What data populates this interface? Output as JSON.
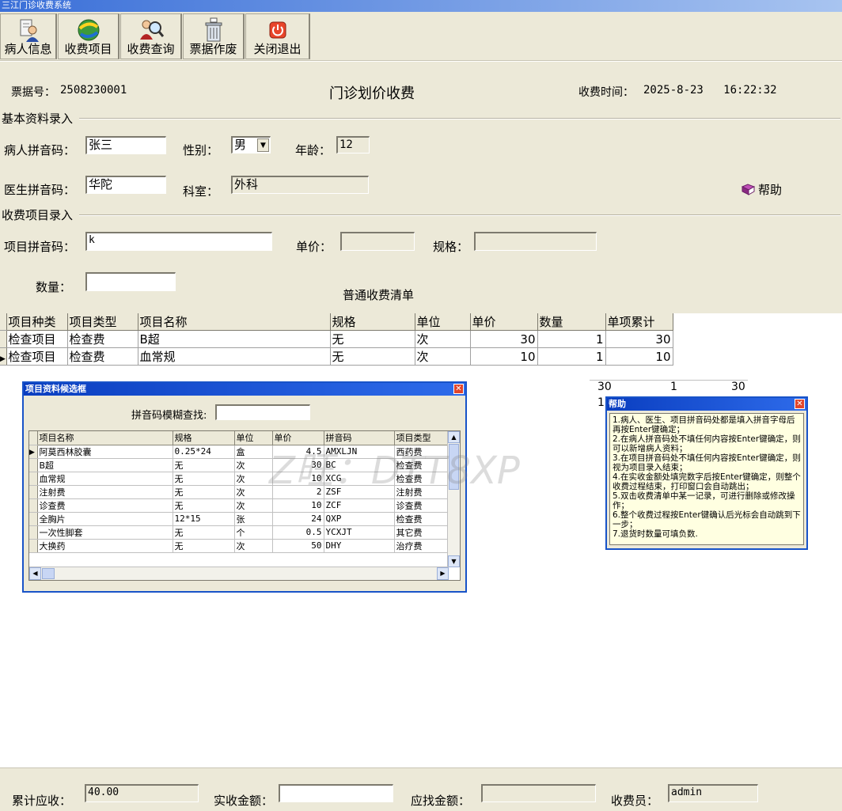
{
  "window": {
    "title": "三江门诊收费系统"
  },
  "toolbar": [
    {
      "label": "病人信息",
      "icon": "patient-icon"
    },
    {
      "label": "收费项目",
      "icon": "charge-items-icon"
    },
    {
      "label": "收费查询",
      "icon": "search-icon"
    },
    {
      "label": "票据作废",
      "icon": "trash-icon"
    },
    {
      "label": "关闭退出",
      "icon": "power-icon"
    }
  ],
  "header": {
    "receipt_label": "票据号：",
    "receipt_no": "2508230001",
    "title": "门诊划价收费",
    "time_label": "收费时间：",
    "time_value": "2025-8-23   16:22:32"
  },
  "basic": {
    "section": "基本资料录入",
    "patient_label": "病人拼音码：",
    "patient_value": "张三",
    "gender_label": "性别：",
    "gender_value": "男",
    "age_label": "年龄：",
    "age_value": "12",
    "doctor_label": "医生拼音码：",
    "doctor_value": "华陀",
    "dept_label": "科室：",
    "dept_value": "外科",
    "help_label": "帮助"
  },
  "item": {
    "section": "收费项目录入",
    "code_label": "项目拼音码：",
    "code_value": "k",
    "price_label": "单价：",
    "price_value": "",
    "spec_label": "规格：",
    "spec_value": "",
    "qty_label": "数量：",
    "qty_value": "",
    "list_title": "普通收费清单"
  },
  "main_grid": {
    "headers": [
      "项目种类",
      "项目类型",
      "项目名称",
      "规格",
      "单位",
      "单价",
      "数量",
      "单项累计"
    ],
    "rows": [
      [
        "检查项目",
        "检查费",
        "B超",
        "无",
        "次",
        "30",
        "1",
        "30"
      ],
      [
        "检查项目",
        "检查费",
        "血常规",
        "无",
        "次",
        "10",
        "1",
        "10"
      ]
    ]
  },
  "behind_row": {
    "a": "30",
    "b": "1",
    "c": "30",
    "d": "1"
  },
  "candidate": {
    "title": "项目资料候选框",
    "search_label": "拼音码模糊查找:",
    "search_value": "",
    "headers": [
      "项目名称",
      "规格",
      "单位",
      "单价",
      "拼音码",
      "项目类型"
    ],
    "rows": [
      [
        "阿莫西林胶囊",
        "0.25*24",
        "盒",
        "4.5",
        "AMXLJN",
        "西药费"
      ],
      [
        "B超",
        "无",
        "次",
        "30",
        "BC",
        "检查费"
      ],
      [
        "血常规",
        "无",
        "次",
        "10",
        "XCG",
        "检查费"
      ],
      [
        "注射费",
        "无",
        "次",
        "2",
        "ZSF",
        "注射费"
      ],
      [
        "诊查费",
        "无",
        "次",
        "10",
        "ZCF",
        "诊查费"
      ],
      [
        "全胸片",
        "12*15",
        "张",
        "24",
        "QXP",
        "检查费"
      ],
      [
        "一次性脚套",
        "无",
        "个",
        "0.5",
        "YCXJT",
        "其它费"
      ],
      [
        "大换药",
        "无",
        "次",
        "50",
        "DHY",
        "治疗费"
      ]
    ]
  },
  "help": {
    "title": "帮助",
    "lines": [
      "1.病人、医生、项目拼音码处都是填入拼音字母后再按Enter键确定；",
      "2.在病人拼音码处不填任何内容按Enter键确定，则可以新增病人资料；",
      "3.在项目拼音码处不填任何内容按Enter键确定，则视为项目录入结束；",
      "4.在实收金额处填完数字后按Enter键确定，则整个收费过程结束，打印窗口会自动跳出；",
      "5.双击收费清单中某一记录，可进行删除或修改操作；",
      "6.整个收费过程按Enter键确认后光标会自动跳到下一步；",
      "7.退货时数量可填负数."
    ]
  },
  "footer": {
    "total_label": "累计应收：",
    "total_value": "40.00",
    "paid_label": "实收金额：",
    "paid_value": "",
    "change_label": "应找金额：",
    "change_value": "",
    "cashier_label": "收费员：",
    "cashier_value": "admin"
  },
  "watermark": "Z旺：DTT8XP",
  "colors": {
    "face": "#ece9d8",
    "title_blue": "#1853c8",
    "help_bg": "#ffffe1"
  }
}
